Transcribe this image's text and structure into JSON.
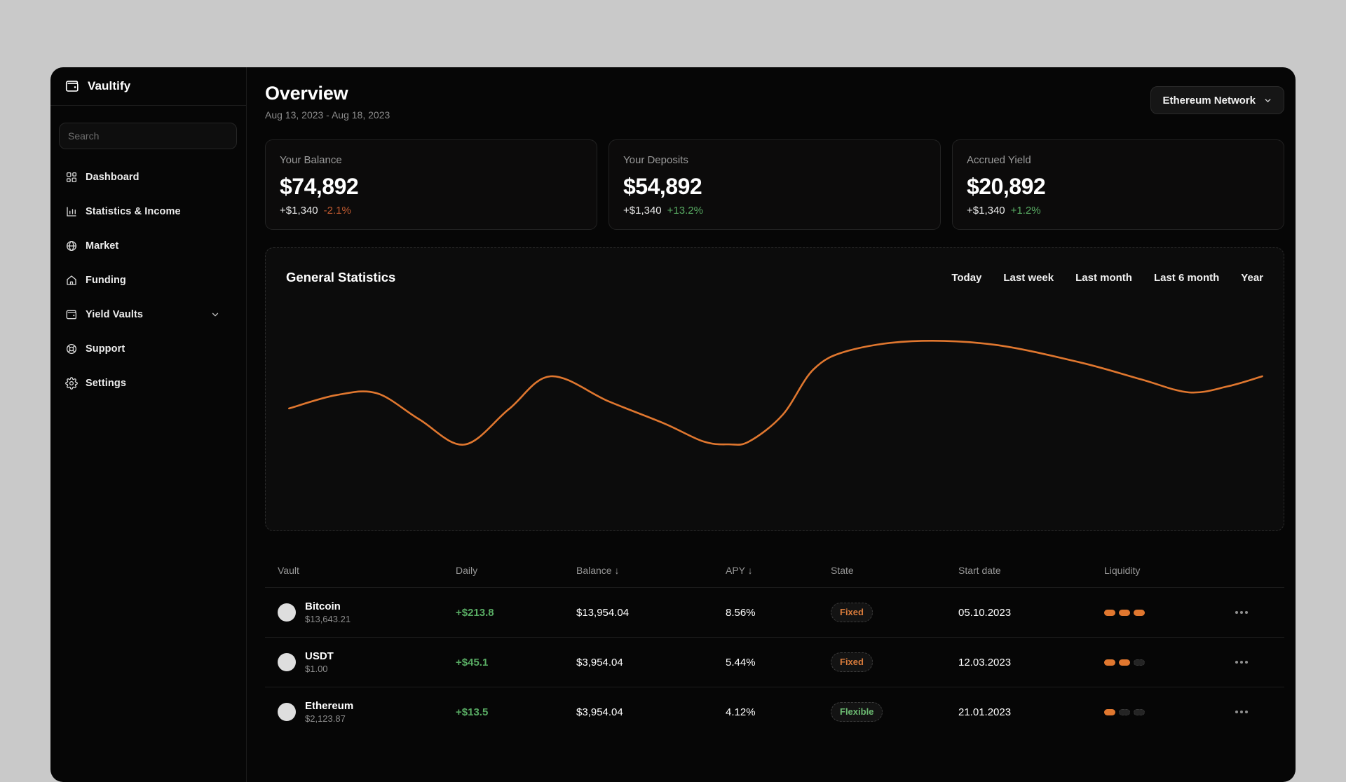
{
  "brand": {
    "name": "Vaultify"
  },
  "sidebar": {
    "search_placeholder": "Search",
    "items": [
      {
        "label": "Dashboard"
      },
      {
        "label": "Statistics & Income"
      },
      {
        "label": "Market"
      },
      {
        "label": "Funding"
      },
      {
        "label": "Yield Vaults"
      },
      {
        "label": "Support"
      },
      {
        "label": "Settings"
      }
    ]
  },
  "header": {
    "title": "Overview",
    "date_range": "Aug 13, 2023 - Aug 18, 2023",
    "network_button": "Ethereum Network"
  },
  "stats": [
    {
      "label": "Your Balance",
      "value": "$74,892",
      "delta": "+$1,340",
      "percent": "-2.1%",
      "percent_color": "#c05a30"
    },
    {
      "label": "Your Deposits",
      "value": "$54,892",
      "delta": "+$1,340",
      "percent": "+13.2%",
      "percent_color": "#58ab63"
    },
    {
      "label": "Accrued Yield",
      "value": "$20,892",
      "delta": "+$1,340",
      "percent": "+1.2%",
      "percent_color": "#58ab63"
    }
  ],
  "chart": {
    "title": "General Statistics",
    "filters": [
      "Today",
      "Last week",
      "Last month",
      "Last 6 month",
      "Year"
    ],
    "line_color": "#e0772f"
  },
  "chart_data": {
    "type": "line",
    "title": "General Statistics",
    "x": [
      2.3,
      6.9,
      10.9,
      15.1,
      19.5,
      23.9,
      28.0,
      33.7,
      39.2,
      43.0,
      45.5,
      47.5,
      50.8,
      53.8,
      57.2,
      63.5,
      71.5,
      80.0,
      86.0,
      90.7,
      94.5,
      97.9
    ],
    "y": [
      43.2,
      47.9,
      48.6,
      39.3,
      30.4,
      43.0,
      54.6,
      45.7,
      37.8,
      31.5,
      30.5,
      31.5,
      41.0,
      57.0,
      63.6,
      67.0,
      65.8,
      59.5,
      53.5,
      48.9,
      51.0,
      54.6
    ],
    "xlabel": "",
    "ylabel": "",
    "axes_hidden": true,
    "grid": false,
    "legend": false
  },
  "table": {
    "columns": [
      "Vault",
      "Daily",
      "Balance",
      "APY",
      "State",
      "Start date",
      "Liquidity"
    ],
    "sort_arrow": "↓",
    "rows": [
      {
        "name": "Bitcoin",
        "price": "$13,643.21",
        "daily": "+$213.8",
        "daily_color": "#58ab63",
        "balance": "$13,954.04",
        "apy": "8.56%",
        "state": "Fixed",
        "state_color": "orange",
        "start_date": "05.10.2023",
        "liquidity": 3
      },
      {
        "name": "USDT",
        "price": "$1.00",
        "daily": "+$45.1",
        "daily_color": "#58ab63",
        "balance": "$3,954.04",
        "apy": "5.44%",
        "state": "Fixed",
        "state_color": "orange",
        "start_date": "12.03.2023",
        "liquidity": 2
      },
      {
        "name": "Ethereum",
        "price": "$2,123.87",
        "daily": "+$13.5",
        "daily_color": "#58ab63",
        "balance": "$3,954.04",
        "apy": "4.12%",
        "state": "Flexible",
        "state_color": "green",
        "start_date": "21.01.2023",
        "liquidity": 1
      }
    ]
  }
}
